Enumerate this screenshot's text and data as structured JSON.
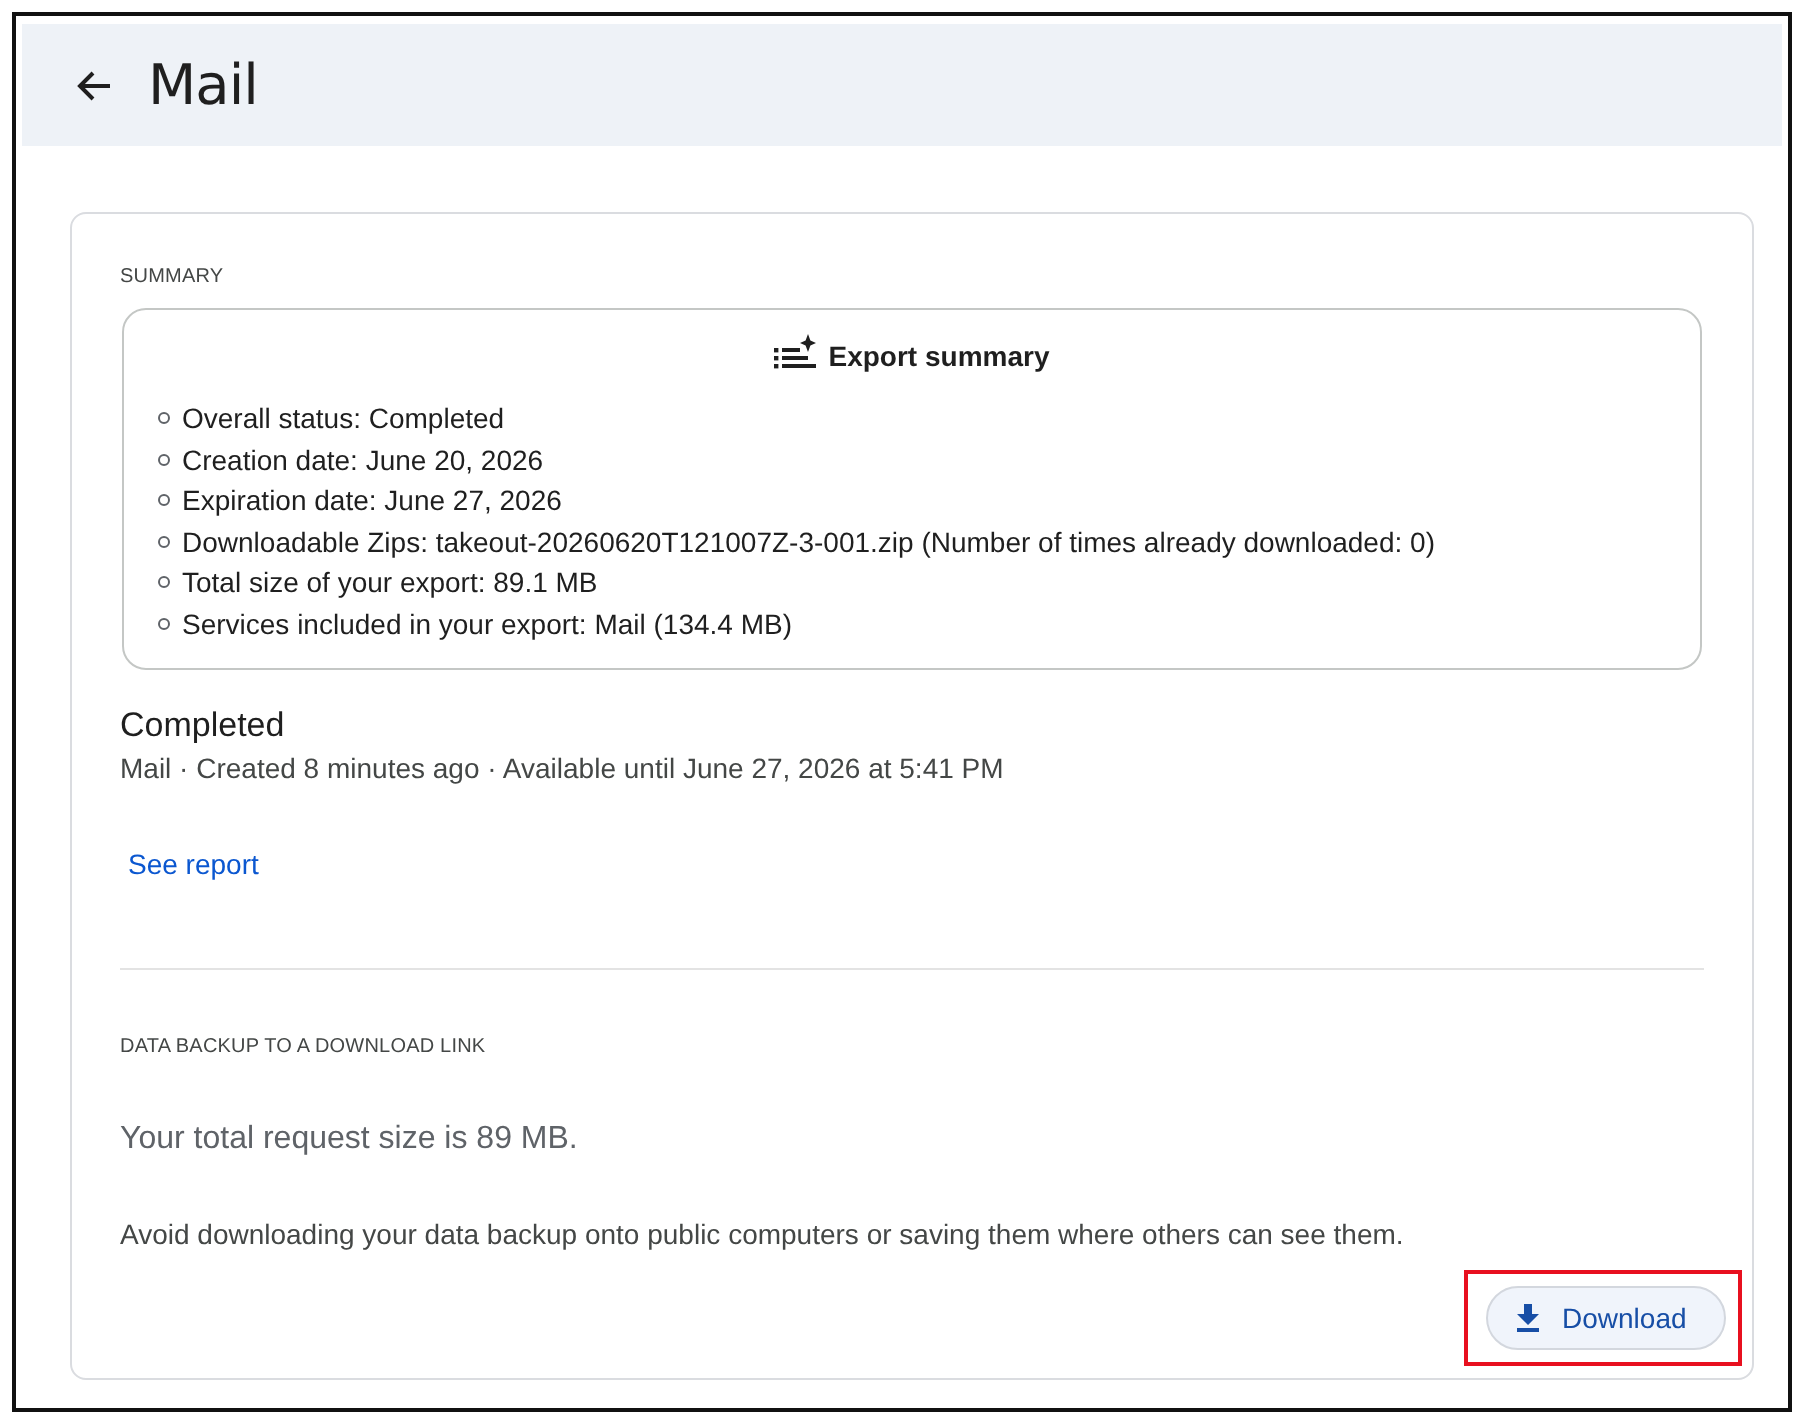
{
  "header": {
    "title": "Mail"
  },
  "summary": {
    "section_label": "SUMMARY",
    "heading": "Export summary",
    "items": [
      "Overall status: Completed",
      "Creation date: June 20, 2026",
      "Expiration date: June 27, 2026",
      "Downloadable Zips: takeout-20260620T121007Z-3-001.zip (Number of times already downloaded: 0)",
      "Total size of your export: 89.1 MB",
      "Services included in your export: Mail (134.4 MB)"
    ]
  },
  "status": {
    "title": "Completed",
    "details": "Mail · Created 8 minutes ago · Available until June 27, 2026 at 5:41 PM",
    "link": "See report"
  },
  "download_section": {
    "section_label": "DATA BACKUP TO A DOWNLOAD LINK",
    "request_size": "Your total request size is 89 MB.",
    "warning": "Avoid downloading your data backup onto public computers or saving them where others can see them.",
    "button": {
      "label": "Download",
      "highlighted": true
    }
  }
}
